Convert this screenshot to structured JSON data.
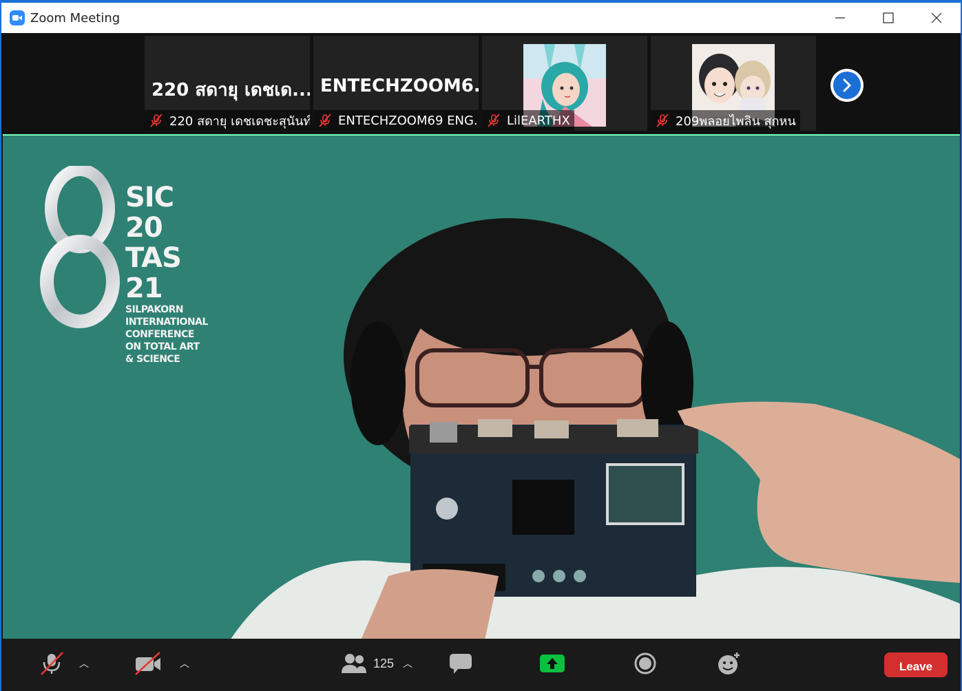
{
  "window": {
    "title": "Zoom Meeting"
  },
  "thumbnails": [
    {
      "big_name": "220 สดายุ เดชเด...",
      "label": "220 สดายุ เดชเดชะสุนันท์",
      "muted": true
    },
    {
      "big_name": "ENTECHZOOM6...",
      "label": "ENTECHZOOM69 ENG...",
      "muted": true
    },
    {
      "big_name": "",
      "label": "LilEARTHX",
      "muted": true,
      "avatar": "anime-girl-avatar"
    },
    {
      "big_name": "",
      "label": "209พลอยไพลิน สุกหน",
      "muted": true,
      "avatar": "anime-couple-avatar"
    }
  ],
  "main_video": {
    "background_color": "#2e8173",
    "logo": {
      "line1": "SIC 20",
      "line2": "TAS 21",
      "subtitle": [
        "SILPAKORN",
        "INTERNATIONAL",
        "CONFERENCE",
        "ON TOTAL ART",
        "& SCIENCE"
      ]
    }
  },
  "toolbar": {
    "participants_count": "125",
    "leave_label": "Leave",
    "share_color": "#0bbf3f",
    "leave_color": "#d32f2f"
  }
}
